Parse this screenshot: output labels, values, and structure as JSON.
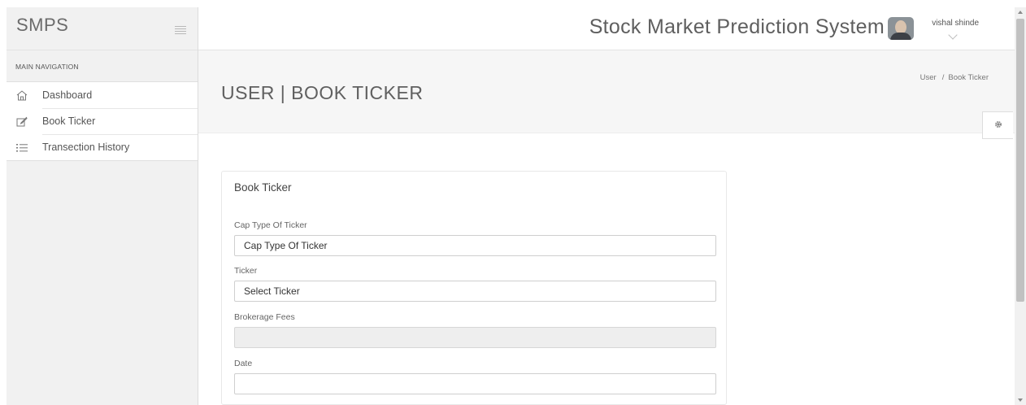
{
  "brand": {
    "name": "SMPS"
  },
  "sidebar": {
    "heading": "MAIN NAVIGATION",
    "items": [
      {
        "label": "Dashboard",
        "icon": "home-icon"
      },
      {
        "label": "Book Ticker",
        "icon": "edit-icon"
      },
      {
        "label": "Transection History",
        "icon": "list-icon"
      }
    ]
  },
  "header": {
    "title": "Stock Market Prediction System",
    "user_name": "vishal shinde"
  },
  "page": {
    "title": "USER | BOOK TICKER",
    "breadcrumb": [
      "User",
      "Book Ticker"
    ],
    "breadcrumb_separator": "/"
  },
  "form": {
    "title": "Book Ticker",
    "fields": [
      {
        "label": "Cap Type Of Ticker",
        "value": "Cap Type Of Ticker"
      },
      {
        "label": "Ticker",
        "value": "Select Ticker"
      },
      {
        "label": "Brokerage Fees",
        "value": ""
      },
      {
        "label": "Date",
        "value": ""
      }
    ]
  }
}
